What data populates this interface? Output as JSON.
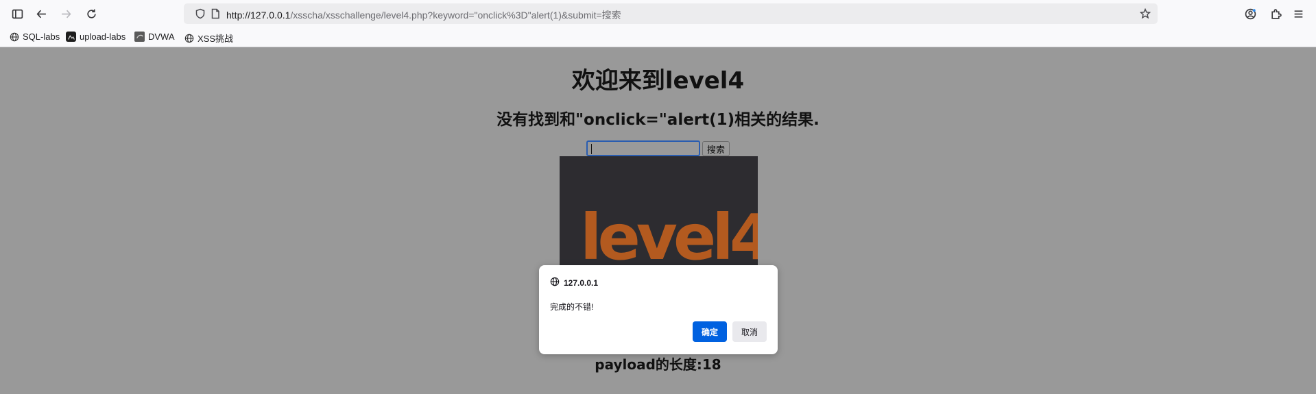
{
  "browser": {
    "url_host": "http://127.0.0.1",
    "url_path": "/xsscha/xsschallenge/level4.php?keyword=\"onclick%3D\"alert(1)&submit=搜索",
    "bookmarks": [
      {
        "label": "SQL-labs",
        "icon": "globe-icon"
      },
      {
        "label": "upload-labs",
        "icon": "folder-icon"
      },
      {
        "label": "DVWA",
        "icon": "dvwa-icon"
      },
      {
        "label": "XSS挑战",
        "icon": "globe-icon"
      }
    ]
  },
  "page": {
    "heading": "欢迎来到level4",
    "result_text": "没有找到和\"onclick=\"alert(1)相关的结果.",
    "search_value": "",
    "search_button": "搜索",
    "level_image_text": "level4",
    "payload_length": "payload的长度:18"
  },
  "dialog": {
    "origin": "127.0.0.1",
    "message": "完成的不错!",
    "ok_label": "确定",
    "cancel_label": "取消"
  },
  "colors": {
    "overlay_bg": "#999999",
    "accent": "#0061e0",
    "logo_orange": "#b35a1f"
  }
}
